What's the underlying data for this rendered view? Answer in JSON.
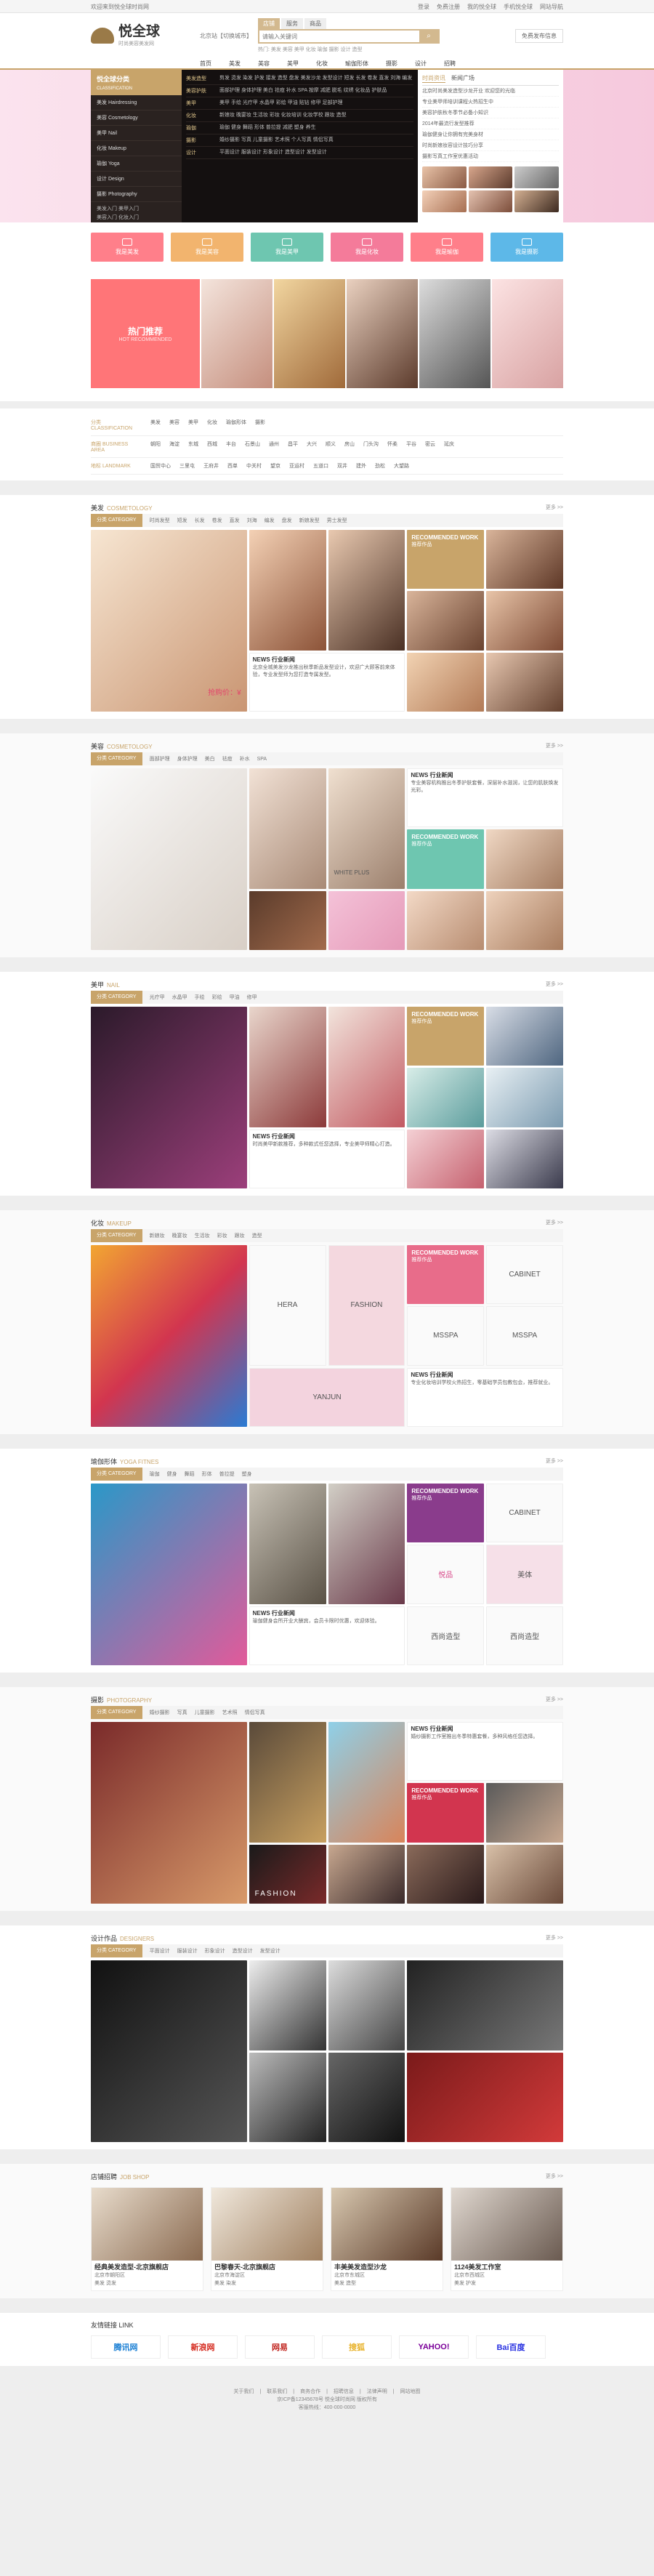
{
  "topbar": {
    "left": "欢迎来到悦全球时尚网",
    "links": [
      "登录",
      "免费注册",
      "我的悦全球",
      "手机悦全球",
      "网站导航"
    ]
  },
  "header": {
    "logo_title": "悦全球",
    "logo_sub": "时尚美容美发网",
    "city": "北京站【切换城市】",
    "search_tabs": [
      "店铺",
      "服务",
      "商品"
    ],
    "search_placeholder": "请输入关键词",
    "hot_words": "热门: 美发 美容 美甲 化妆 瑜伽 摄影 设计 造型",
    "publish": "免费发布信息"
  },
  "nav": [
    "首页",
    "美发",
    "美容",
    "美甲",
    "化妆",
    "瑜伽形体",
    "摄影",
    "设计",
    "招聘"
  ],
  "category": {
    "head_title": "悦全球分类",
    "head_sub": "CLASSIFICATION",
    "items": [
      "美发 Hairdressing",
      "美容 Cosmetology",
      "美甲 Nail",
      "化妆 Makeup",
      "瑜伽 Yoga",
      "设计 Design",
      "摄影 Photography"
    ],
    "sub": [
      "美发入门",
      "美甲入门",
      "美容入门",
      "化妆入门"
    ]
  },
  "mega": [
    {
      "label": "美发造型",
      "text": "剪发 烫发 染发 护发 接发 造型 盘发 美发沙龙 发型设计 短发 长发 卷发 直发 刘海 编发"
    },
    {
      "label": "美容护肤",
      "text": "面部护理 身体护理 美白 祛痘 补水 SPA 按摩 减肥 脱毛 纹绣 化妆品 护肤品"
    },
    {
      "label": "美甲",
      "text": "美甲 手绘 光疗甲 水晶甲 彩绘 甲油 贴钻 修甲 足部护理"
    },
    {
      "label": "化妆",
      "text": "新娘妆 晚宴妆 生活妆 彩妆 化妆培训 化妆学校 跟妆 造型"
    },
    {
      "label": "瑜伽",
      "text": "瑜伽 健身 舞蹈 形体 普拉提 减肥 塑身 养生"
    },
    {
      "label": "摄影",
      "text": "婚纱摄影 写真 儿童摄影 艺术照 个人写真 情侣写真"
    },
    {
      "label": "设计",
      "text": "平面设计 服装设计 形象设计 造型设计 发型设计"
    }
  ],
  "news_tabs": [
    "时尚资讯",
    "新闻广场"
  ],
  "news_list": [
    "北京时尚美发造型沙龙开业 欢迎您的光临",
    "专业美甲师培训课程火热招生中",
    "美容护肤秋冬季节必备小知识",
    "2014年最流行发型推荐",
    "瑜伽健身让你拥有完美身材",
    "时尚新娘妆容设计技巧分享",
    "摄影写真工作室优惠活动"
  ],
  "quick": [
    {
      "label": "我是美发",
      "color": "#ff7f8a"
    },
    {
      "label": "我是美容",
      "color": "#f2b46e"
    },
    {
      "label": "我是美甲",
      "color": "#6ec6b0"
    },
    {
      "label": "我是化妆",
      "color": "#f47b9a"
    },
    {
      "label": "我是瑜伽",
      "color": "#ff7f8a"
    },
    {
      "label": "我是摄影",
      "color": "#5db8e8"
    }
  ],
  "hot_rec": {
    "title": "热门推荐",
    "sub": "HOT RECOMMENDED"
  },
  "filters": [
    {
      "label": "分类 CLASSIFICATION",
      "items": [
        "美发",
        "美容",
        "美甲",
        "化妆",
        "瑜伽形体",
        "摄影"
      ]
    },
    {
      "label": "商圈 BUSINESS AREA",
      "items": [
        "朝阳",
        "海淀",
        "东城",
        "西城",
        "丰台",
        "石景山",
        "通州",
        "昌平",
        "大兴",
        "顺义",
        "房山",
        "门头沟",
        "怀柔",
        "平谷",
        "密云",
        "延庆"
      ]
    },
    {
      "label": "地标 LANDMARK",
      "items": [
        "国贸中心",
        "三里屯",
        "王府井",
        "西单",
        "中关村",
        "望京",
        "亚运村",
        "五道口",
        "双井",
        "建外",
        "劲松",
        "大望路"
      ]
    }
  ],
  "sections": [
    {
      "cn": "美发",
      "en": "COSMETOLOGY",
      "tags": [
        "时尚发型",
        "短发",
        "长发",
        "卷发",
        "直发",
        "刘海",
        "编发",
        "盘发",
        "新娘发型",
        "男士发型"
      ],
      "rec_title": "RECOMMENDED WORK",
      "rec_cn": "推荐作品",
      "news_title": "NEWS 行业新闻",
      "news_text": "北京全城美发沙龙推出秋季新品发型设计，欢迎广大顾客前来体验，专业发型师为您打造专属发型。",
      "price": "抢购价：¥"
    },
    {
      "cn": "美容",
      "en": "COSMETOLOGY",
      "tags": [
        "面部护理",
        "身体护理",
        "美白",
        "祛痘",
        "补水",
        "SPA"
      ],
      "rec_title": "RECOMMENDED WORK",
      "rec_cn": "推荐作品",
      "news_title": "NEWS 行业新闻",
      "news_text": "专业美容机构推出冬季护肤套餐，深层补水滋润，让您的肌肤焕发光彩。",
      "brand": "WHITE PLUS"
    },
    {
      "cn": "美甲",
      "en": "NAIL",
      "tags": [
        "光疗甲",
        "水晶甲",
        "手绘",
        "彩绘",
        "甲油",
        "修甲"
      ],
      "rec_title": "RECOMMENDED WORK",
      "rec_cn": "推荐作品",
      "news_title": "NEWS 行业新闻",
      "news_text": "时尚美甲新款推荐，多种款式任您选择，专业美甲师精心打造。"
    },
    {
      "cn": "化妆",
      "en": "MAKEUP",
      "tags": [
        "新娘妆",
        "晚宴妆",
        "生活妆",
        "彩妆",
        "跟妆",
        "造型"
      ],
      "rec_title": "RECOMMENDED WORK",
      "rec_cn": "推荐作品",
      "news_title": "NEWS 行业新闻",
      "news_text": "专业化妆培训学校火热招生，零基础学员包教包会，推荐就业。",
      "brands": [
        "HERA",
        "FASHION",
        "YANJUN",
        "CABINET",
        "MSSPA",
        "MSSPA"
      ]
    },
    {
      "cn": "瑜伽形体",
      "en": "YOGA FITNES",
      "tags": [
        "瑜伽",
        "健身",
        "舞蹈",
        "形体",
        "普拉提",
        "塑身"
      ],
      "rec_title": "RECOMMENDED WORK",
      "rec_cn": "推荐作品",
      "news_title": "NEWS 行业新闻",
      "news_text": "瑜伽健身会所开业大酬宾，会员卡限时优惠，欢迎体验。",
      "brands": [
        "CABINET",
        "悦品",
        "美体",
        "西尚造型",
        "西尚造型"
      ]
    },
    {
      "cn": "摄影",
      "en": "PHOTOGRAPHY",
      "tags": [
        "婚纱摄影",
        "写真",
        "儿童摄影",
        "艺术照",
        "情侣写真"
      ],
      "rec_title": "RECOMMENDED WORK",
      "rec_cn": "推荐作品",
      "news_title": "NEWS 行业新闻",
      "news_text": "婚纱摄影工作室推出冬季特惠套餐，多种风格任您选择。",
      "brand": "FASHION"
    },
    {
      "cn": "设计作品",
      "en": "DESIGNERS",
      "tags": [
        "平面设计",
        "服装设计",
        "形象设计",
        "造型设计",
        "发型设计"
      ]
    }
  ],
  "jobshop": {
    "cn": "店铺招聘",
    "en": "JOB SHOP",
    "cards": [
      {
        "name": "经典美发造型-北京旗舰店",
        "addr": "北京市朝阳区",
        "tags": "美发 烫发"
      },
      {
        "name": "巴黎春天-北京旗舰店",
        "addr": "北京市海淀区",
        "tags": "美发 染发"
      },
      {
        "name": "丰美美发造型沙龙",
        "addr": "北京市东城区",
        "tags": "美发 造型"
      },
      {
        "name": "1124美发工作室",
        "addr": "北京市西城区",
        "tags": "美发 护发"
      }
    ]
  },
  "links": {
    "title": "友情链接 LINK",
    "logos": [
      {
        "name": "腾讯网",
        "color": "#1a7fd4"
      },
      {
        "name": "新浪网",
        "color": "#d4261a"
      },
      {
        "name": "网易",
        "color": "#c0231d"
      },
      {
        "name": "搜狐",
        "color": "#e8b22a"
      },
      {
        "name": "YAHOO!",
        "color": "#7b0099"
      },
      {
        "name": "Bai百度",
        "color": "#2932e1"
      }
    ]
  },
  "footer": {
    "nav": [
      "关于我们",
      "联系我们",
      "商务合作",
      "招聘信息",
      "法律声明",
      "网站地图"
    ],
    "line1": "京ICP备12345678号 悦全球时尚网 版权所有",
    "line2": "客服热线：400-000-0000"
  },
  "colors": {
    "accent": "#c8a46a",
    "pink": "#ff7578"
  }
}
